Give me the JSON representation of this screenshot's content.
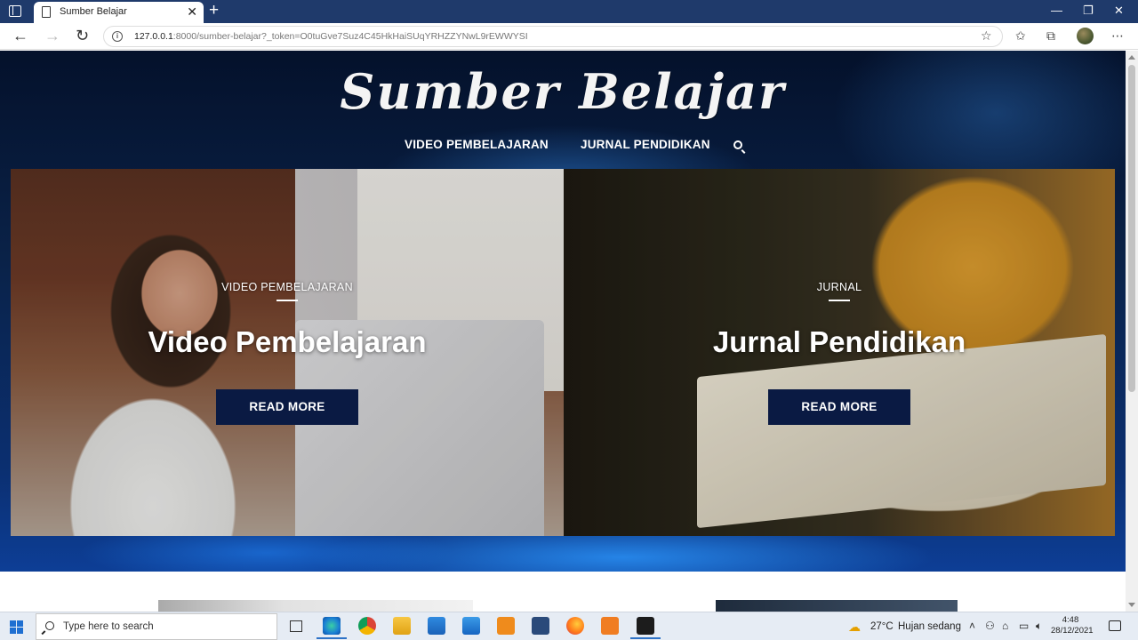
{
  "browser": {
    "tab_title": "Sumber Belajar",
    "tab_close": "✕",
    "new_tab": "+",
    "url_host": "127.0.0.1",
    "url_rest": ":8000/sumber-belajar?_token=O0tuGve7Suz4C45HkHaiSUqYRHZZYNwL9rEWWYSI",
    "window_controls": {
      "minimize": "—",
      "maximize": "❐",
      "close": "✕"
    },
    "nav": {
      "back": "←",
      "forward": "→",
      "reload": "↻"
    },
    "toolbar_icons": [
      "favorite-add-icon",
      "favorites-icon",
      "collections-icon",
      "profile-avatar",
      "more-icon"
    ],
    "more": "⋯"
  },
  "site": {
    "logo": "Sumber Belajar",
    "nav": [
      "VIDEO PEMBELAJARAN",
      "JURNAL PENDIDIKAN"
    ]
  },
  "cards": [
    {
      "category": "VIDEO PEMBELAJARAN",
      "title": "Video Pembelajaran",
      "button": "READ MORE"
    },
    {
      "category": "JURNAL",
      "title": "Jurnal Pendidikan",
      "button": "READ MORE"
    }
  ],
  "taskbar": {
    "search_placeholder": "Type here to search",
    "apps": [
      "edge",
      "chrome",
      "file-explorer",
      "store",
      "mail",
      "sublime-text",
      "visual-studio",
      "firefox",
      "xampp",
      "terminal"
    ],
    "weather_temp": "27°C",
    "weather_desc": "Hujan sedang",
    "time": "4:48",
    "date": "28/12/2021"
  },
  "colors": {
    "titlebar": "#1f3a6b",
    "button_bg": "#0a1a43",
    "hero_dark": "#04112b",
    "hero_blue": "#0d3e96"
  }
}
